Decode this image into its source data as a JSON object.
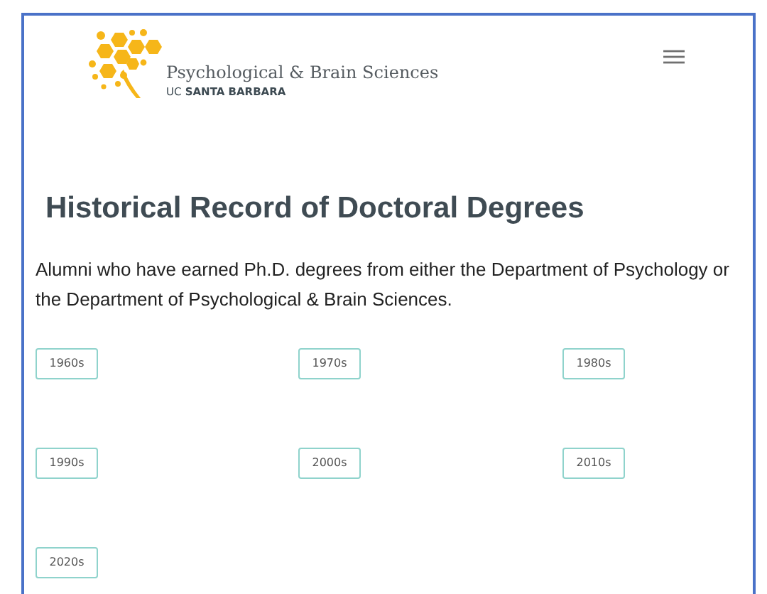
{
  "header": {
    "title": "Psychological & Brain Sciences",
    "subtitle_prefix": "UC",
    "subtitle": "SANTA BARBARA"
  },
  "heading": "Historical Record of Doctoral Degrees",
  "intro": "Alumni who have earned Ph.D. degrees from either the Department of Psychology or the Department of Psychological & Brain Sciences.",
  "decades": [
    "1960s",
    "1970s",
    "1980s",
    "1990s",
    "2000s",
    "2010s",
    "2020s"
  ]
}
